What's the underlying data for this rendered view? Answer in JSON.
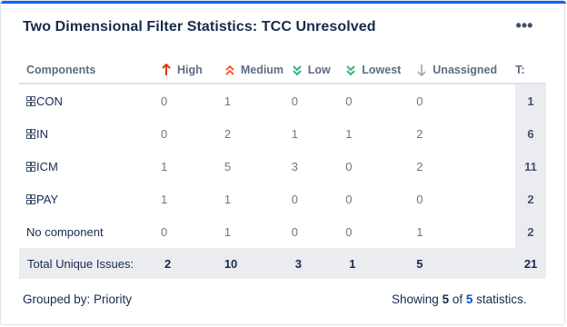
{
  "gadget": {
    "title": "Two Dimensional Filter Statistics: TCC Unresolved",
    "more_label": "•••"
  },
  "table": {
    "headers": {
      "components": "Components",
      "high": "High",
      "medium": "Medium",
      "low": "Low",
      "lowest": "Lowest",
      "unassigned": "Unassigned",
      "total": "T:"
    },
    "priority_colors": {
      "high": "#de350b",
      "medium": "#ff5630",
      "low": "#36b37e",
      "lowest": "#36b37e",
      "unassigned": "#97a0af"
    },
    "rows": [
      {
        "component": "CON",
        "icon": "component-icon",
        "high": "0",
        "medium": "1",
        "low": "0",
        "lowest": "0",
        "unassigned": "0",
        "total": "1"
      },
      {
        "component": "IN",
        "icon": "component-icon",
        "high": "0",
        "medium": "2",
        "low": "1",
        "lowest": "1",
        "unassigned": "2",
        "total": "6"
      },
      {
        "component": "ICM",
        "icon": "component-icon",
        "high": "1",
        "medium": "5",
        "low": "3",
        "lowest": "0",
        "unassigned": "2",
        "total": "11"
      },
      {
        "component": "PAY",
        "icon": "component-icon",
        "high": "1",
        "medium": "1",
        "low": "0",
        "lowest": "0",
        "unassigned": "0",
        "total": "2"
      },
      {
        "component": "No component",
        "icon": "",
        "high": "0",
        "medium": "1",
        "low": "0",
        "lowest": "0",
        "unassigned": "1",
        "total": "2"
      }
    ],
    "totals": {
      "label": "Total Unique Issues:",
      "high": "2",
      "medium": "10",
      "low": "3",
      "lowest": "1",
      "unassigned": "5",
      "total": "21"
    }
  },
  "footer": {
    "grouped_by": "Grouped by: Priority",
    "showing_prefix": "Showing",
    "showing_count": "5",
    "showing_of": "of",
    "showing_total": "5",
    "showing_suffix": "statistics."
  }
}
